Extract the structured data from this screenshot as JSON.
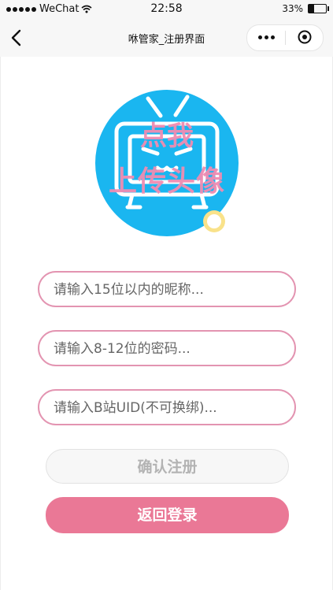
{
  "statusbar": {
    "carrier": "WeChat",
    "time": "22:58",
    "battery": "33%",
    "battery_level": 0.33
  },
  "navbar": {
    "title": "咻管家_注册界面"
  },
  "avatar": {
    "line1": "点我",
    "line2": "上传头像"
  },
  "form": {
    "nickname_placeholder": "请输入15位以内的昵称...",
    "password_placeholder": "请输入8-12位的密码...",
    "uid_placeholder": "请输入B站UID(不可换绑)..."
  },
  "buttons": {
    "confirm": "确认注册",
    "back_login": "返回登录"
  },
  "colors": {
    "accent_pink": "#ea7896",
    "field_border": "#e394b1",
    "avatar_blue": "#1ab6f0"
  }
}
